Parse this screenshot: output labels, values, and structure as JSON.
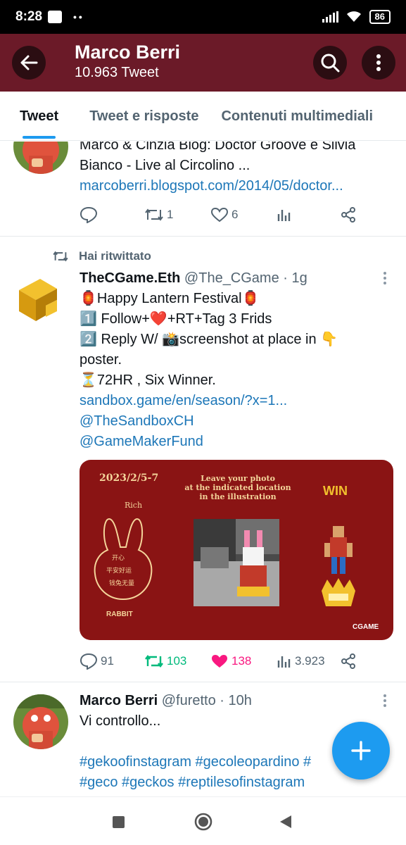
{
  "status_bar": {
    "time": "8:28",
    "dots": "••",
    "battery": "86"
  },
  "header": {
    "name": "Marco Berri",
    "tweet_count": "10.963 Tweet"
  },
  "tabs": [
    {
      "label": "Tweet",
      "active": true
    },
    {
      "label": "Tweet e risposte",
      "active": false
    },
    {
      "label": "Contenuti multimediali",
      "active": false
    }
  ],
  "tweets": [
    {
      "text_lines": [
        "Marco & Cinzia Blog: Doctor Groove e Silvia",
        "Bianco - Live al Circolino ..."
      ],
      "link": "marcoberri.blogspot.com/2014/05/doctor...",
      "replies": "",
      "retweets": "1",
      "likes": "6"
    },
    {
      "retweeted_label": "Hai ritwittato",
      "author": "TheCGame.Eth",
      "handle": "@The_CGame",
      "time": "· 1g",
      "line1": "🏮Happy Lantern Festival🏮",
      "line2": "1️⃣ Follow+❤️+RT+Tag 3 Frids",
      "line3": "2️⃣ Reply W/ 📸screenshot  at place in 👇",
      "line4": "poster.",
      "line5": "⏳72HR , Six Winner.",
      "link": "sandbox.game/en/season/?x=1...",
      "mention1": "@TheSandboxCH",
      "mention2": "@GameMakerFund",
      "image": {
        "date": "2023/2/5-7",
        "rich": "Rich",
        "headline1": "Leave your photo",
        "headline2": "at the indicated location",
        "headline3": "in the illustration",
        "win": "WIN",
        "rabbit": "RABBIT",
        "brand": "CGAME"
      },
      "replies": "91",
      "retweets": "103",
      "likes": "138",
      "views": "3.923"
    },
    {
      "author": "Marco Berri",
      "handle": "@furetto",
      "time": "· 10h",
      "text": "Vi controllo...",
      "hashtags1": "#gekoofinstagram #gecoleopardino #",
      "hashtags2": "#geco #geckos #reptilesofinstagram"
    }
  ],
  "colors": {
    "header_bg": "#6b1a28",
    "accent": "#1d9bf0",
    "retweet": "#00ba7c",
    "like": "#f91880"
  },
  "icons": [
    "back-arrow-icon",
    "search-icon",
    "more-vertical-icon",
    "reply-icon",
    "retweet-icon",
    "heart-icon",
    "views-icon",
    "share-icon",
    "plus-icon"
  ]
}
